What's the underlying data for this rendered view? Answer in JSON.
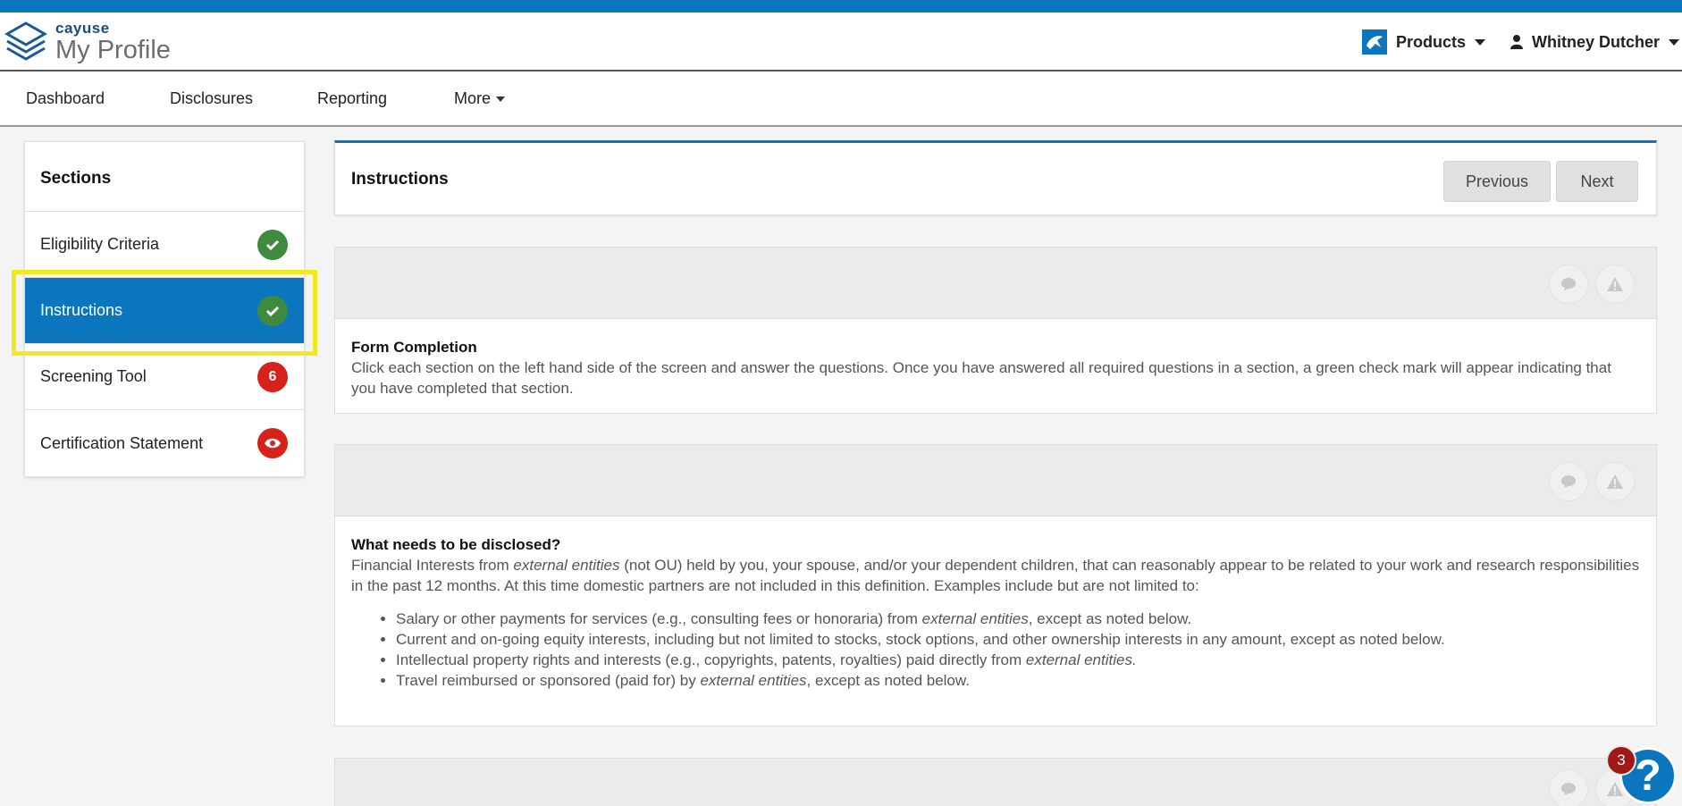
{
  "header": {
    "brand_small": "cayuse",
    "brand_large": "My Profile",
    "products_label": "Products",
    "user_name": "Whitney Dutcher"
  },
  "nav": {
    "items": [
      {
        "label": "Dashboard"
      },
      {
        "label": "Disclosures"
      },
      {
        "label": "Reporting"
      },
      {
        "label": "More"
      }
    ]
  },
  "sidebar": {
    "title": "Sections",
    "items": [
      {
        "label": "Eligibility Criteria",
        "badge": "check",
        "badge_color": "#3f8a3f"
      },
      {
        "label": "Instructions",
        "badge": "check",
        "badge_color": "#3f8a3f",
        "active": true
      },
      {
        "label": "Screening Tool",
        "badge": "6",
        "badge_color": "#d6221b"
      },
      {
        "label": "Certification Statement",
        "badge": "eye",
        "badge_color": "#d6221b"
      }
    ]
  },
  "main": {
    "title": "Instructions",
    "previous_label": "Previous",
    "next_label": "Next",
    "sections": [
      {
        "title": "Form Completion",
        "text": "Click each section on the left hand side of the screen and answer the questions. Once you have answered all required questions in a section, a green check mark will appear indicating that you have completed that section."
      },
      {
        "title": "What needs to be disclosed?",
        "intro_a": "Financial Interests from ",
        "intro_em": "external entities",
        "intro_b": " (not OU) held by you, your spouse, and/or your dependent children, that can reasonably appear to be related to your work and research responsibilities in the past 12 months.  At this time domestic partners are not included in this definition.  Examples include but are not limited to:",
        "bullets": [
          {
            "a": "Salary or other payments for services (e.g., consulting fees or honoraria) from ",
            "em": "external entities",
            "b": ", except as noted below."
          },
          {
            "a": "Current and on-going equity interests, including but not limited to stocks, stock options, and other ownership interests in any amount, except as noted below.",
            "em": "",
            "b": ""
          },
          {
            "a": "Intellectual property rights and interests (e.g., copyrights, patents, royalties) paid directly from ",
            "em": "external entities.",
            "b": ""
          },
          {
            "a": "Travel reimbursed or sponsored (paid for) by ",
            "em": "external entities",
            "b": ", except as noted below."
          }
        ]
      }
    ]
  },
  "help": {
    "label": "?",
    "count": "3"
  },
  "colors": {
    "brand_blue": "#0b76bd",
    "success_green": "#3f8a3f",
    "alert_red": "#d6221b",
    "highlight_yellow": "#f3e824"
  }
}
